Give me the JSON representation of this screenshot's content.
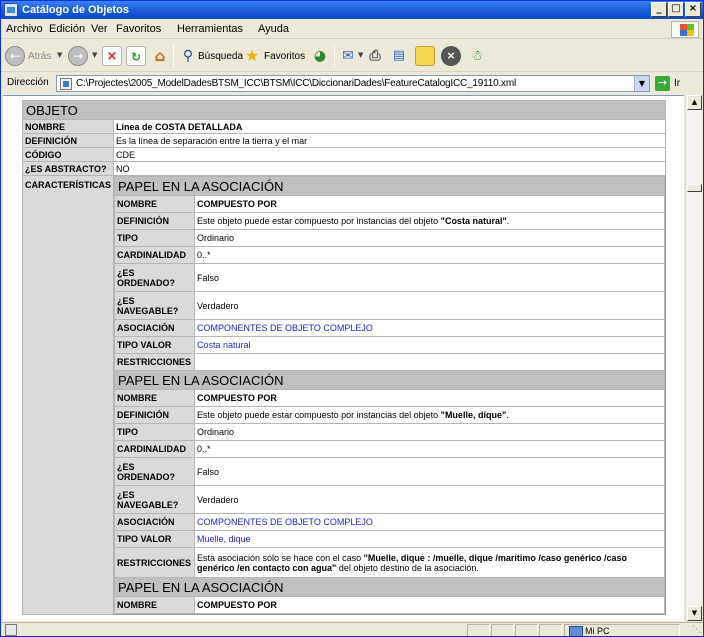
{
  "window": {
    "title": "Catálogo de Objetos",
    "controls": [
      "_",
      "□",
      "×"
    ]
  },
  "menu": {
    "archivo": "Archivo",
    "edicion": "Edición",
    "ver": "Ver",
    "favoritos": "Favoritos",
    "herramientas": "Herramientas",
    "ayuda": "Ayuda"
  },
  "toolbar": {
    "back_label": "Atrás",
    "search_label": "Búsqueda",
    "favorites_label": "Favoritos"
  },
  "address": {
    "label": "Dirección",
    "url": "C:\\Projectes\\2005_ModelDadesBTSM_ICC\\BTSM\\ICC\\DiccionariDades\\FeatureCatalogICC_19110.xml",
    "go_label": "Ir"
  },
  "status": {
    "zone": "Mi PC"
  },
  "doc": {
    "header": "OBJETO",
    "fields": [
      {
        "key": "NOMBRE",
        "value": "Línea de COSTA DETALLADA"
      },
      {
        "key": "DEFINICIÓN",
        "value": "Es la línea de separación entre la tierra y el mar"
      },
      {
        "key": "CÓDIGO",
        "value": "CDE"
      },
      {
        "key": "¿ES ABSTRACTO?",
        "value": "NO"
      }
    ],
    "characteristics_key": "CARACTERÍSTICAS",
    "role_header": "PAPEL EN LA ASOCIACIÓN",
    "role_labels": {
      "nombre": "NOMBRE",
      "definicion": "DEFINICIÓN",
      "tipo": "TIPO",
      "cardinalidad": "CARDINALIDAD",
      "ordenado_1": "¿ES",
      "ordenado_2": "ORDENADO?",
      "navegable_1": "¿ES",
      "navegable_2": "NAVEGABLE?",
      "asociacion": "ASOCIACIÓN",
      "tipo_valor": "TIPO VALOR",
      "restricciones": "RESTRICCIONES"
    },
    "roles": [
      {
        "nombre": "COMPUESTO POR",
        "def_pre": "Este objeto puede estar compuesto por instancias del objeto ",
        "def_bold": "\"Costa natural\"",
        "def_post": ".",
        "tipo": "Ordinario",
        "cardinalidad": "0..*",
        "ordenado": "Falso",
        "navegable": "Verdadero",
        "asociacion": "COMPONENTES DE OBJETO COMPLEJO",
        "tipo_valor": "Costa natural",
        "restr_pre": "",
        "restr_bold": "",
        "restr_post": ""
      },
      {
        "nombre": "COMPUESTO POR",
        "def_pre": "Este objeto puede estar compuesto por instancias del objeto ",
        "def_bold": "\"Muelle, dique\"",
        "def_post": ".",
        "tipo": "Ordinario",
        "cardinalidad": "0..*",
        "ordenado": "Falso",
        "navegable": "Verdadero",
        "asociacion": "COMPONENTES DE OBJETO COMPLEJO",
        "tipo_valor": "Muelle, dique",
        "restr_pre": "Esta asociación sólo se hace con el caso ",
        "restr_bold": "\"Muelle, dique : /muelle, dique /marítimo /caso genérico /caso genérico /en contacto con agua\"",
        "restr_post": " del objeto destino de la asociación."
      },
      {
        "nombre": "COMPUESTO POR"
      }
    ]
  },
  "colors": {
    "title_gradient": "#1c5fdc",
    "header_bg": "#c0c0c0",
    "key_bg": "#dadada",
    "link": "#1f1fcc"
  }
}
